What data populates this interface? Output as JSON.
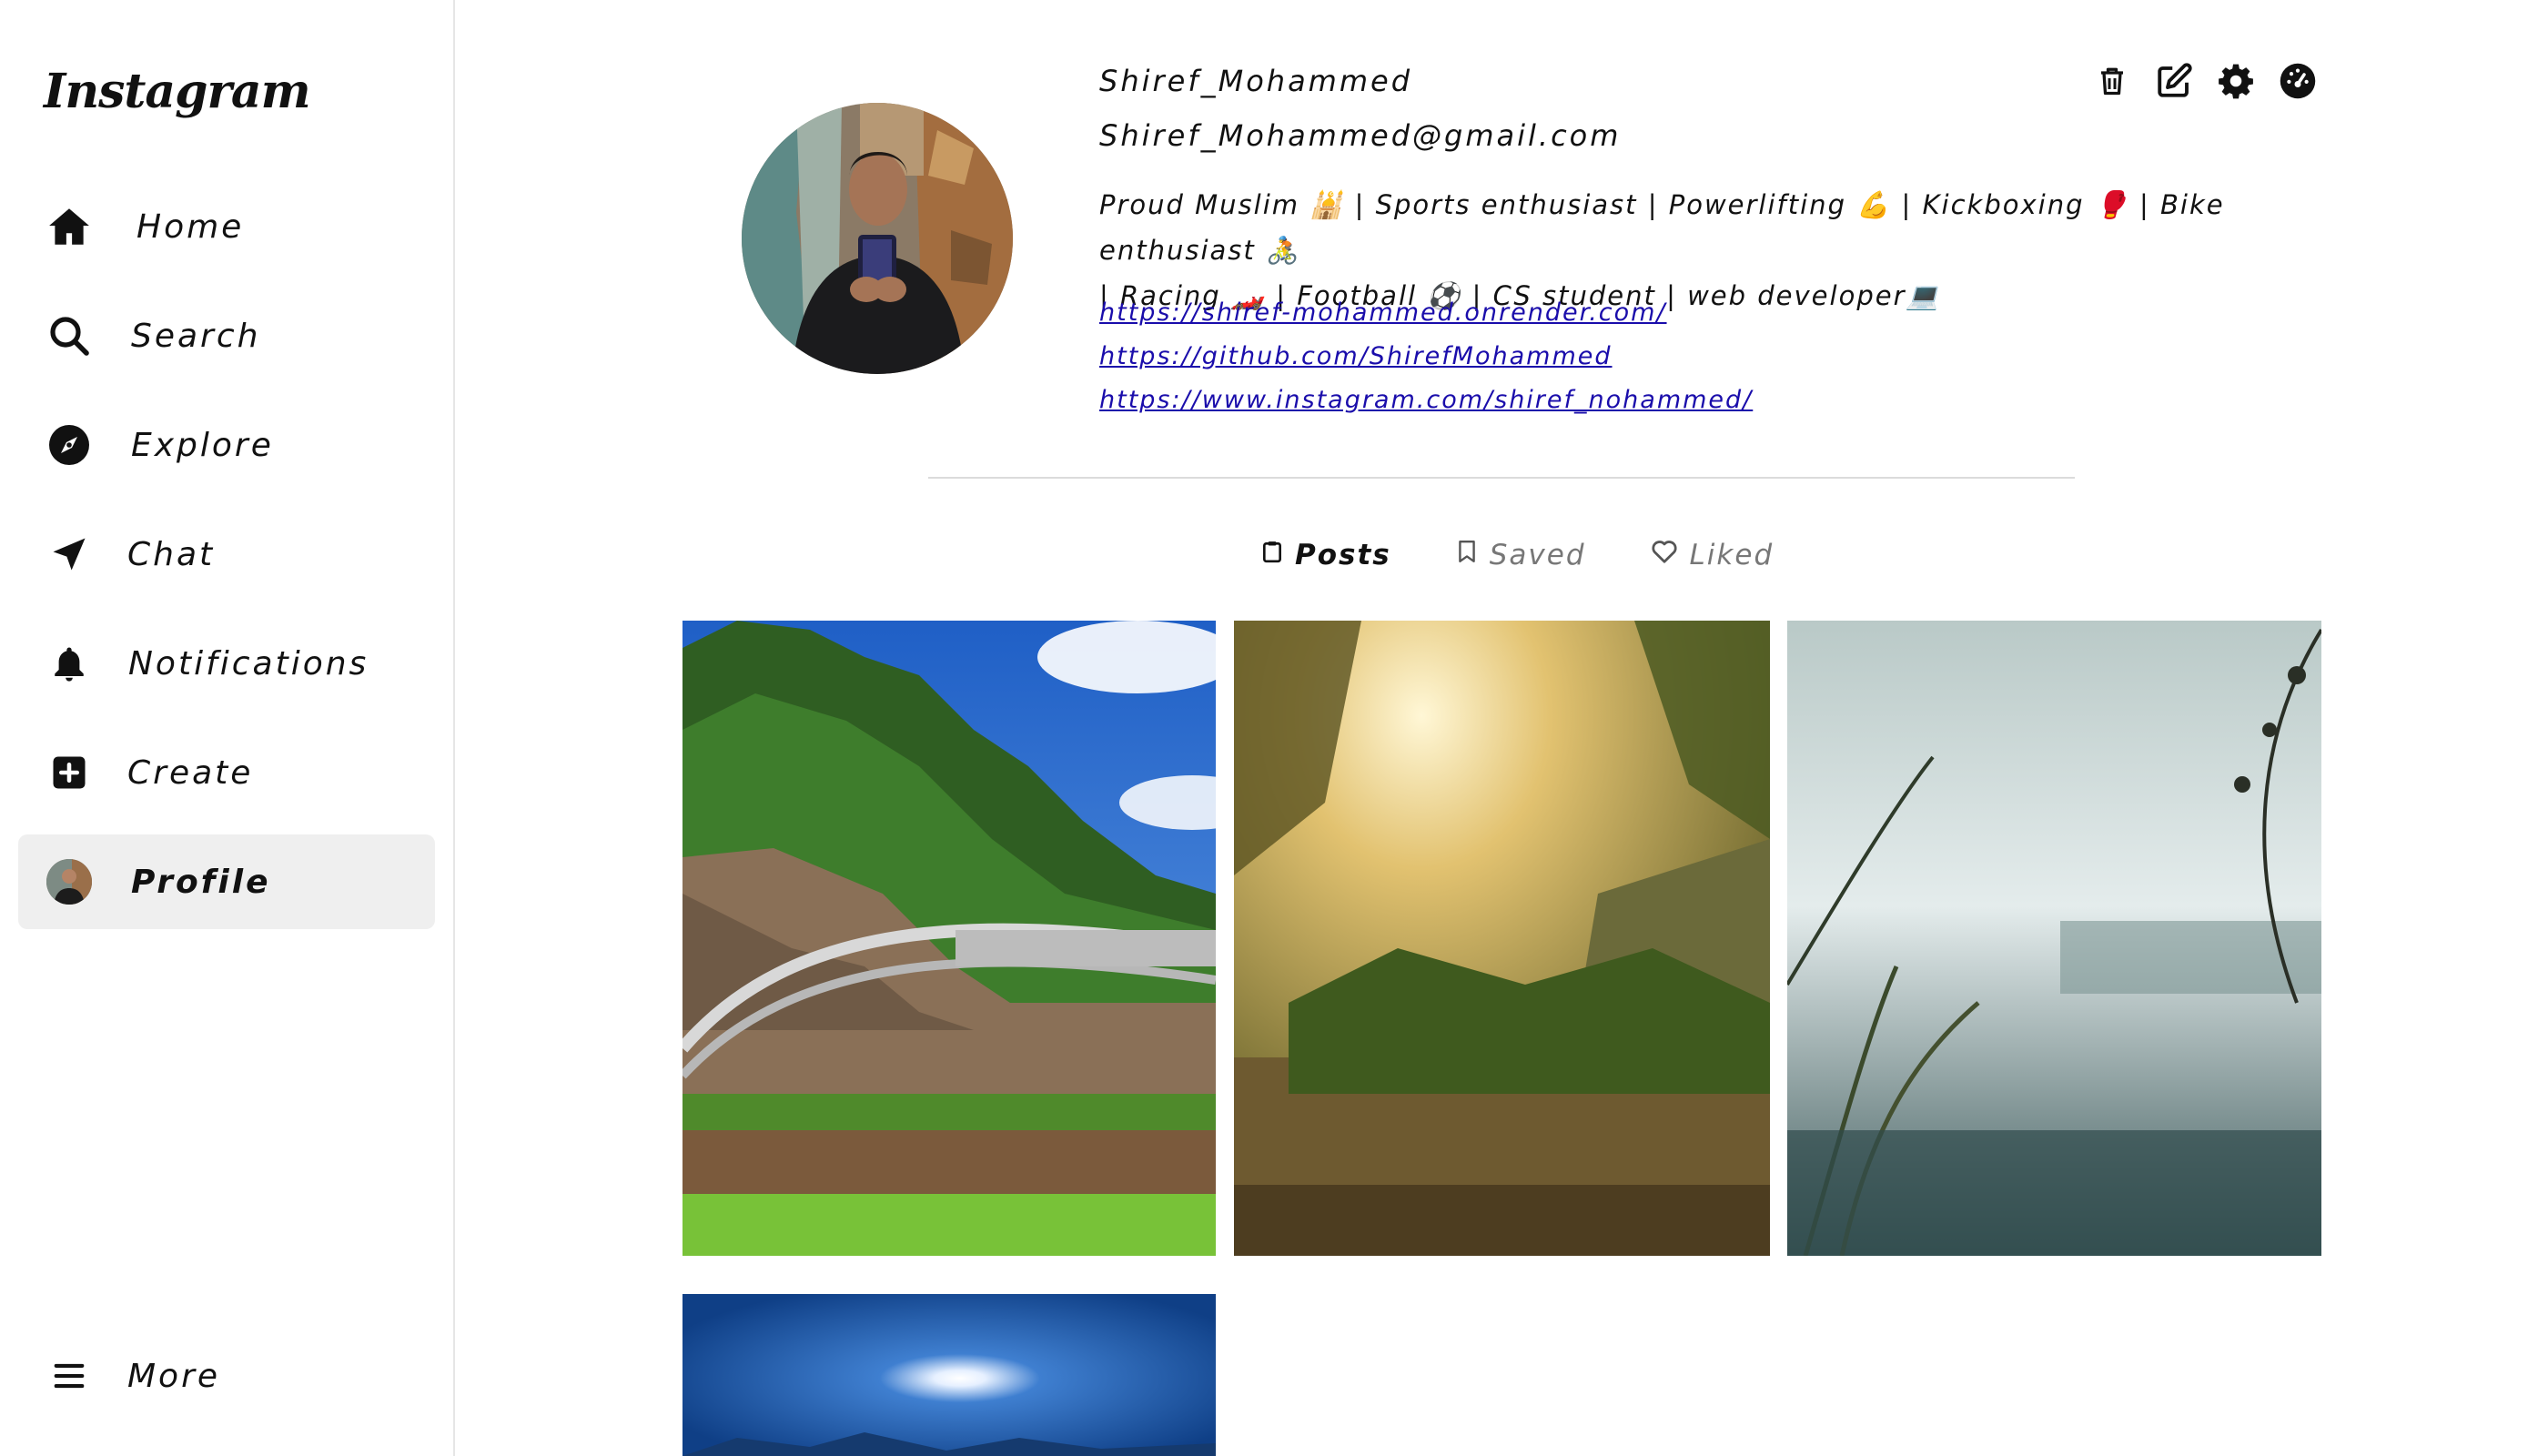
{
  "app": {
    "logo": "Instagram"
  },
  "sidebar": {
    "items": [
      {
        "label": "Home",
        "icon": "home-icon"
      },
      {
        "label": "Search",
        "icon": "search-icon"
      },
      {
        "label": "Explore",
        "icon": "compass-icon"
      },
      {
        "label": "Chat",
        "icon": "send-icon"
      },
      {
        "label": "Notifications",
        "icon": "bell-icon"
      },
      {
        "label": "Create",
        "icon": "plus-square-icon"
      },
      {
        "label": "Profile",
        "icon": "avatar",
        "active": true
      }
    ],
    "more": {
      "label": "More",
      "icon": "hamburger-icon"
    }
  },
  "profile": {
    "username": "Shiref_Mohammed",
    "email": "Shiref_Mohammed@gmail.com",
    "bio_line1": "Proud Muslim 🕌 | Sports enthusiast | Powerlifting 💪 | Kickboxing 🥊 | Bike enthusiast 🚴",
    "bio_line2": "| Racing 🏎️ | Football ⚽ | CS student | web developer💻",
    "links": [
      "https://shiref-mohammed.onrender.com/",
      "https://github.com/ShirefMohammed",
      "https://www.instagram.com/shiref_nohammed/"
    ]
  },
  "actions": [
    "trash-icon",
    "edit-icon",
    "gear-icon",
    "dashboard-icon"
  ],
  "tabs": [
    {
      "label": "Posts",
      "icon": "clipboard-icon",
      "active": true
    },
    {
      "label": "Saved",
      "icon": "bookmark-icon"
    },
    {
      "label": "Liked",
      "icon": "heart-icon"
    }
  ],
  "posts": [
    {
      "name": "bridge-forest-photo"
    },
    {
      "name": "sunlit-forest-photo"
    },
    {
      "name": "misty-lake-photo"
    },
    {
      "name": "night-sky-photo"
    }
  ],
  "colors": {
    "link": "#1a0dab",
    "active_bg": "#efefef",
    "divider": "#dbdbdb"
  }
}
